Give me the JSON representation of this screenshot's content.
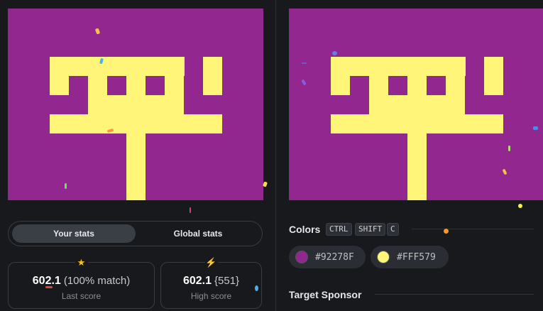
{
  "toggle": {
    "active": "Your stats",
    "inactive": "Global stats"
  },
  "stats": {
    "last": {
      "score": "602.1",
      "detail": "(100% match)",
      "label": "Last score",
      "icon": "star-icon"
    },
    "high": {
      "score": "602.1",
      "detail": "{551}",
      "label": "High score",
      "icon": "lightning-icon"
    }
  },
  "colors_section": {
    "title": "Colors",
    "shortcut": [
      "CTRL",
      "SHIFT",
      "C"
    ],
    "colors": [
      {
        "hex": "#92278F",
        "label": "#92278F"
      },
      {
        "hex": "#FFF579",
        "label": "#FFF579"
      }
    ]
  },
  "sponsor_section": {
    "title": "Target Sponsor"
  },
  "palette": {
    "background": "#17191d",
    "purple": "#92278F",
    "yellow": "#FFF579"
  }
}
